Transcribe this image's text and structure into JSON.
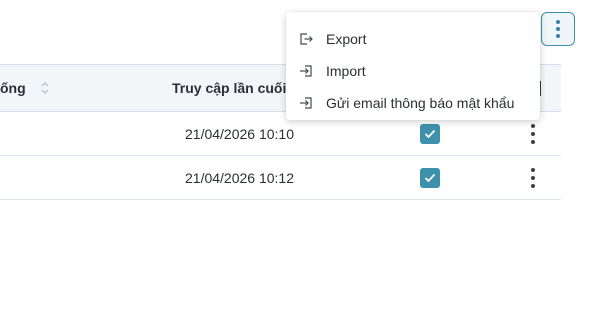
{
  "table": {
    "columns": {
      "system": "ống",
      "last_access": "Truy cập lần cuối"
    },
    "rows": [
      {
        "last_access": "21/04/2026 10:10",
        "checked": true
      },
      {
        "last_access": "21/04/2026 10:12",
        "checked": true
      }
    ]
  },
  "menu": {
    "items": [
      {
        "label": "Export",
        "icon": "export-icon"
      },
      {
        "label": "Import",
        "icon": "import-icon"
      },
      {
        "label": "Gửi email thông báo mật khẩu",
        "icon": "send-email-icon"
      }
    ]
  },
  "colors": {
    "accent": "#3d91ad",
    "header_bg": "#f3f6f9",
    "border": "#d7dee6"
  }
}
